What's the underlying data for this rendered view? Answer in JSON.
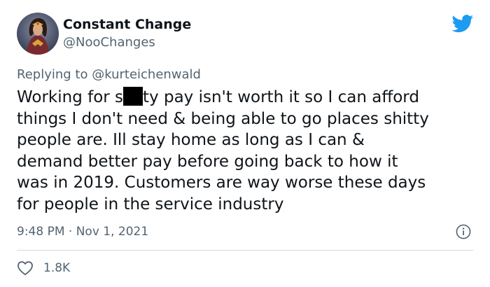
{
  "author": {
    "display_name": "Constant Change",
    "handle": "@NooChanges",
    "avatar_icon": "wonder-woman-avatar"
  },
  "brand": {
    "icon": "twitter-bird-icon",
    "color": "#1d9bf0"
  },
  "reply": {
    "prefix": "Replying to ",
    "mention": "@kurteichenwald"
  },
  "tweet": {
    "text_lines": [
      {
        "before": "Working for s",
        "after": "ty pay isn't worth it so I can afford",
        "redacted": true
      },
      {
        "text": "things I don't need & being able to go places shitty"
      },
      {
        "text": "people are. Ill stay home as long as I can &"
      },
      {
        "text": "demand better pay before going back to how it"
      },
      {
        "text": "was in 2019. Customers are way worse these days"
      },
      {
        "text": "for people in the service industry"
      }
    ],
    "timestamp": "9:48 PM · Nov 1, 2021"
  },
  "engagement": {
    "likes": "1.8K",
    "like_icon": "heart-icon"
  },
  "colors": {
    "text": "#0f1419",
    "secondary": "#536471",
    "divider": "#cfd9de"
  }
}
